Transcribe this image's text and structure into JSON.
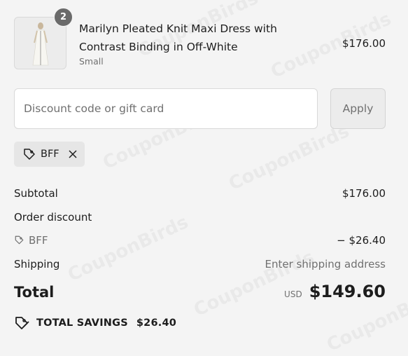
{
  "line_item": {
    "quantity": "2",
    "title": "Marilyn Pleated Knit Maxi Dress with Contrast Binding in Off-White",
    "variant": "Small",
    "price": "$176.00"
  },
  "discount": {
    "placeholder": "Discount code or gift card",
    "value": "",
    "apply_label": "Apply",
    "applied_code": "BFF"
  },
  "summary": {
    "subtotal_label": "Subtotal",
    "subtotal_value": "$176.00",
    "order_discount_label": "Order discount",
    "discount_code": "BFF",
    "discount_value": "− $26.40",
    "shipping_label": "Shipping",
    "shipping_value": "Enter shipping address",
    "total_label": "Total",
    "currency": "USD",
    "total_value": "$149.60",
    "savings_label": "TOTAL SAVINGS",
    "savings_value": "$26.40"
  },
  "watermark": "CouponBirds",
  "icons": {
    "tag": "tag-icon",
    "remove": "close-icon",
    "savings": "savings-tag-icon"
  },
  "colors": {
    "background": "#f4f4f4",
    "text": "#1d1d1d",
    "muted": "#707070",
    "badge": "#6a6a6a"
  }
}
